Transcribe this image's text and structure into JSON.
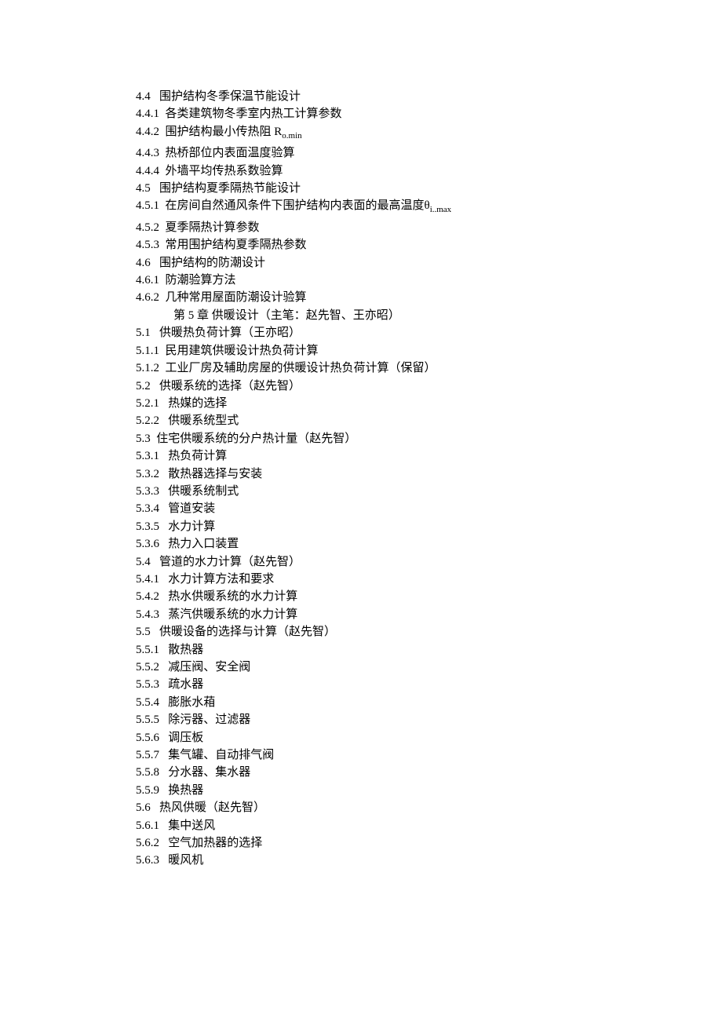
{
  "toc": [
    {
      "num": "4.4",
      "gap": "   ",
      "text": "围护结构冬季保温节能设计",
      "suffix": ""
    },
    {
      "num": "4.4.1",
      "gap": "  ",
      "text": "各类建筑物冬季室内热工计算参数",
      "suffix": ""
    },
    {
      "num": "4.4.2",
      "gap": "  ",
      "text": "围护结构最小传热阻 R",
      "suffix": "o.min"
    },
    {
      "num": "4.4.3",
      "gap": "  ",
      "text": "热桥部位内表面温度验算",
      "suffix": ""
    },
    {
      "num": "4.4.4",
      "gap": "  ",
      "text": "外墙平均传热系数验算",
      "suffix": ""
    },
    {
      "num": "4.5",
      "gap": "   ",
      "text": "围护结构夏季隔热节能设计",
      "suffix": ""
    },
    {
      "num": "4.5.1",
      "gap": "  ",
      "text": "在房间自然通风条件下围护结构内表面的最高温度θ",
      "suffix": "i..max"
    },
    {
      "num": "4.5.2",
      "gap": "  ",
      "text": "夏季隔热计算参数",
      "suffix": ""
    },
    {
      "num": "4.5.3",
      "gap": "  ",
      "text": "常用围护结构夏季隔热参数",
      "suffix": ""
    },
    {
      "num": "4.6",
      "gap": "   ",
      "text": "围护结构的防潮设计",
      "suffix": ""
    },
    {
      "num": "4.6.1",
      "gap": "  ",
      "text": "防潮验算方法",
      "suffix": ""
    },
    {
      "num": "4.6.2",
      "gap": "  ",
      "text": "几种常用屋面防潮设计验算",
      "suffix": ""
    }
  ],
  "chapter": "第 5 章      供暖设计（主笔：赵先智、王亦昭）",
  "toc2": [
    {
      "num": "5.1",
      "gap": "   ",
      "text": "供暖热负荷计算（王亦昭）"
    },
    {
      "num": "5.1.1",
      "gap": "  ",
      "text": "民用建筑供暖设计热负荷计算"
    },
    {
      "num": "5.1.2",
      "gap": "  ",
      "text": "工业厂房及辅助房屋的供暖设计热负荷计算（保留）"
    },
    {
      "num": "5.2",
      "gap": "   ",
      "text": "供暖系统的选择（赵先智）"
    },
    {
      "num": "5.2.1",
      "gap": "   ",
      "text": "热媒的选择"
    },
    {
      "num": "5.2.2",
      "gap": "   ",
      "text": "供暖系统型式"
    },
    {
      "num": "5.3",
      "gap": "  ",
      "text": "住宅供暖系统的分户热计量（赵先智）"
    },
    {
      "num": "5.3.1",
      "gap": "   ",
      "text": "热负荷计算"
    },
    {
      "num": "5.3.2",
      "gap": "   ",
      "text": "散热器选择与安装"
    },
    {
      "num": "5.3.3",
      "gap": "   ",
      "text": "供暖系统制式"
    },
    {
      "num": "5.3.4",
      "gap": "   ",
      "text": "管道安装"
    },
    {
      "num": "5.3.5",
      "gap": "   ",
      "text": "水力计算"
    },
    {
      "num": "5.3.6",
      "gap": "   ",
      "text": "热力入口装置"
    },
    {
      "num": "5.4",
      "gap": "   ",
      "text": "管道的水力计算（赵先智）"
    },
    {
      "num": "5.4.1",
      "gap": "   ",
      "text": "水力计算方法和要求"
    },
    {
      "num": "5.4.2",
      "gap": "   ",
      "text": "热水供暖系统的水力计算"
    },
    {
      "num": "5.4.3",
      "gap": "   ",
      "text": "蒸汽供暖系统的水力计算"
    },
    {
      "num": "5.5",
      "gap": "   ",
      "text": "供暖设备的选择与计算（赵先智）"
    },
    {
      "num": "5.5.1",
      "gap": "   ",
      "text": "散热器"
    },
    {
      "num": "5.5.2",
      "gap": "   ",
      "text": "减压阀、安全阀"
    },
    {
      "num": "5.5.3",
      "gap": "   ",
      "text": "疏水器"
    },
    {
      "num": "5.5.4",
      "gap": "   ",
      "text": "膨胀水葙"
    },
    {
      "num": "5.5.5",
      "gap": "   ",
      "text": "除污器、过滤器"
    },
    {
      "num": "5.5.6",
      "gap": "   ",
      "text": "调压板"
    },
    {
      "num": "5.5.7",
      "gap": "   ",
      "text": "集气罐、自动排气阀"
    },
    {
      "num": "5.5.8",
      "gap": "   ",
      "text": "分水器、集水器"
    },
    {
      "num": "5.5.9",
      "gap": "   ",
      "text": "换热器"
    },
    {
      "num": "5.6",
      "gap": "   ",
      "text": "热风供暖（赵先智）"
    },
    {
      "num": "5.6.1",
      "gap": "   ",
      "text": "集中送风"
    },
    {
      "num": "5.6.2",
      "gap": "   ",
      "text": "空气加热器的选择"
    },
    {
      "num": "5.6.3",
      "gap": "   ",
      "text": "暖风机"
    }
  ]
}
